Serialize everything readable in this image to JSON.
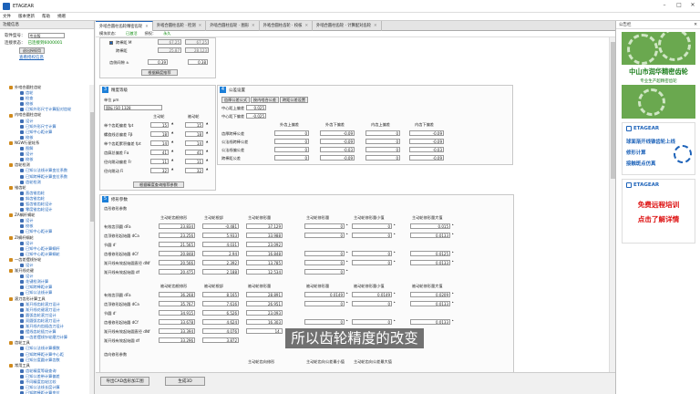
{
  "app": {
    "title": "ETAGEAR"
  },
  "menu": [
    "文件",
    "版本更新",
    "帮助",
    "捐赠"
  ],
  "left": {
    "header": "功能信息",
    "software_label": "软件型号：",
    "software_value": "专业版",
    "conn_label": "连接状态：",
    "conn_value": "已连接到6000001",
    "logout_button": "退出授权用",
    "browse_link": "查看授权信息",
    "tree": [
      {
        "t": "外啮合圆柱齿轮",
        "lv": 0
      },
      {
        "t": "齿轮",
        "lv": 2
      },
      {
        "t": "检查",
        "lv": 2
      },
      {
        "t": "校核",
        "lv": 2
      },
      {
        "t": "已知外形尺寸计算配对齿轮",
        "lv": 2
      },
      {
        "t": "内啮合圆柱齿轮",
        "lv": 0
      },
      {
        "t": "设计",
        "lv": 2
      },
      {
        "t": "已知外形尺寸计算",
        "lv": 2
      },
      {
        "t": "已知中心距计算",
        "lv": 2
      },
      {
        "t": "校核",
        "lv": 2
      },
      {
        "t": "NGW行星轮系",
        "lv": 0
      },
      {
        "t": "图解",
        "lv": 2
      },
      {
        "t": "设计",
        "lv": 2
      },
      {
        "t": "校核",
        "lv": 2
      },
      {
        "t": "齿轮检测",
        "lv": 0
      },
      {
        "t": "已知公法线计算变位系数",
        "lv": 2
      },
      {
        "t": "已知跨棒距计算变位系数",
        "lv": 2
      },
      {
        "t": "齿轮检测",
        "lv": 2
      },
      {
        "t": "锥齿轮",
        "lv": 0
      },
      {
        "t": "直齿锥齿轮",
        "lv": 2
      },
      {
        "t": "斜齿锥齿轮",
        "lv": 2
      },
      {
        "t": "弧齿锥齿轮设计",
        "lv": 2
      },
      {
        "t": "零度锥齿轮设计",
        "lv": 2
      },
      {
        "t": "ZA蜗杆蜗轮",
        "lv": 0
      },
      {
        "t": "设计",
        "lv": 2
      },
      {
        "t": "校核",
        "lv": 2
      },
      {
        "t": "已知中心距计算",
        "lv": 2
      },
      {
        "t": "ZI蜗杆蜗轮",
        "lv": 0
      },
      {
        "t": "设计",
        "lv": 2
      },
      {
        "t": "已知中心距计算蜗杆",
        "lv": 2
      },
      {
        "t": "已知中心距计算蜗轮",
        "lv": 2
      },
      {
        "t": "一齿差摆线针轮",
        "lv": 0
      },
      {
        "t": "设计",
        "lv": 2
      },
      {
        "t": "渐开线花键",
        "lv": 0
      },
      {
        "t": "设计",
        "lv": 2
      },
      {
        "t": "花键检测计算",
        "lv": 2
      },
      {
        "t": "已知跨棒距计算",
        "lv": 2
      },
      {
        "t": "已知公法线计算",
        "lv": 2
      },
      {
        "t": "滚刀齿形计算工具",
        "lv": 0
      },
      {
        "t": "渐开线齿轮滚刀设计",
        "lv": 2
      },
      {
        "t": "渐开线花键滚刀设计",
        "lv": 2
      },
      {
        "t": "圆弧齿轮滚刀设计",
        "lv": 2
      },
      {
        "t": "双圆弧齿轮滚刀设计",
        "lv": 2
      },
      {
        "t": "渐开线内齿插齿刀设计",
        "lv": 2
      },
      {
        "t": "摆线齿轮插刀计算",
        "lv": 2
      },
      {
        "t": "一齿差摆线针轮磨刀计算",
        "lv": 2
      },
      {
        "t": "齿轮工具",
        "lv": 0
      },
      {
        "t": "已知公法线计算模数",
        "lv": 2
      },
      {
        "t": "已知跨棒距计算中心距",
        "lv": 2
      },
      {
        "t": "已知分度圆计算齿数",
        "lv": 2
      },
      {
        "t": "常用工具",
        "lv": 0
      },
      {
        "t": "齿轮精度等级查询",
        "lv": 2
      },
      {
        "t": "已知公差带计算偏差",
        "lv": 2
      },
      {
        "t": "不同精度齿轮比较",
        "lv": 2
      },
      {
        "t": "已知公法线长度计算",
        "lv": 2
      },
      {
        "t": "已知跨棒距计算变位",
        "lv": 2
      }
    ]
  },
  "tabs": [
    {
      "label": "外啮合圆柱齿轮精密齿轮",
      "active": true
    },
    {
      "label": "外啮合圆柱齿轮 · 检测",
      "active": false
    },
    {
      "label": "外啮合圆柱齿轮 · 图形",
      "active": false
    },
    {
      "label": "外啮合圆柱齿轮 · 校核",
      "active": false
    },
    {
      "label": "外啮合圆柱齿轮 · 计算配对齿轮",
      "active": false
    }
  ],
  "status": {
    "a": "模块状态：",
    "b": "已激活",
    "c": "授权：",
    "d": "永久"
  },
  "top_section": {
    "r1_label": "跨棒距 M",
    "r1_v1": "67.25",
    "r1_v2": "67.25",
    "r2_label": "跨棒距",
    "r2_v1": "25.87",
    "r2_v2": "28.123",
    "r3_label": "齿侧间隙 ±",
    "r3_v1": "0.39",
    "r3_v2": "0.38",
    "button": "根据精度推荐"
  },
  "precision": {
    "num": "3",
    "title": "精度等级",
    "unit_label": "单位 µm",
    "standard": "国标 ISO 1328",
    "col1": "主动轮",
    "col2": "被动轮",
    "rows": [
      {
        "l": "单个齿距偏差 fpt",
        "a": "15",
        "b": "15"
      },
      {
        "l": "螺旋线总偏差 Fβ",
        "a": "18",
        "b": "18"
      },
      {
        "l": "单个齿距累积偏差 fpt",
        "a": "14",
        "b": "14"
      },
      {
        "l": "齿廓总偏差 Fα",
        "a": "41",
        "b": "41"
      },
      {
        "l": "径向跳动偏差 Fr",
        "a": "11",
        "b": "11"
      },
      {
        "l": "径向跳动 Fi",
        "a": "32",
        "b": "32"
      }
    ],
    "button": "根据精度查询推荐参数"
  },
  "tolerance": {
    "num": "4",
    "title": "公差设置",
    "btn1": "齿厚公差公式",
    "btn2": "按内啮合公差",
    "btn3": "跨距公差设置",
    "r1": "中心距上偏差",
    "r1v": "0.025",
    "r2": "中心距下偏差",
    "r2v": "-0.025",
    "cols": [
      "外齿上偏差",
      "外齿下偏差",
      "内齿上偏差",
      "内齿下偏差"
    ],
    "rows": [
      {
        "l": "齿厚跨棒公差",
        "v": [
          "0",
          "-0.09",
          "0",
          "-0.09"
        ]
      },
      {
        "l": "公法线跨棒公差",
        "v": [
          "0",
          "-0.09",
          "0",
          "-0.09"
        ]
      },
      {
        "l": "公法线偏公差",
        "v": [
          "0",
          "-0.03",
          "0",
          "-0.03"
        ]
      },
      {
        "l": "跨棒距公差",
        "v": [
          "0",
          "-0.09",
          "0",
          "-0.09"
        ]
      }
    ]
  },
  "measure": {
    "num": "5",
    "title": "修形参数",
    "section1": "齿形修形参数",
    "headers": [
      "主动轮齿根修形",
      "主动轮根部",
      "主动轮修形量",
      "主动轮修形量",
      "主动轮修形量小值",
      "主动轮修形量大值"
    ],
    "rows1": [
      {
        "l": "有效齿顶圆 dFa",
        "v": [
          "23.834",
          "-0.481",
          "37.129",
          "0",
          "0",
          "0.015"
        ]
      },
      {
        "l": "齿顶修形起始圆 dCa",
        "v": [
          "23.256",
          "5.933",
          "33.988",
          "0",
          "0",
          "0.0133"
        ]
      },
      {
        "l": "节圆 d'",
        "v": [
          "21.565",
          "4.031",
          "23.092",
          "",
          "",
          ""
        ]
      },
      {
        "l": "齿根修形起始圆 dCf",
        "v": [
          "20.848",
          "2.94",
          "16.848",
          "0",
          "0",
          "0.0125"
        ]
      },
      {
        "l": "渐开线有效起始圆直径 dNf",
        "v": [
          "20.566",
          "2.392",
          "13.785",
          "0",
          "0",
          "0.0133"
        ]
      },
      {
        "l": "渐开线有效起始圆 df",
        "v": [
          "20.475",
          "2.188",
          "12.534",
          "0",
          "",
          ""
        ]
      }
    ],
    "headers2": [
      "被动轮齿根修形",
      "被动轮根部",
      "被动轮修形量",
      "被动轮修形量",
      "被动轮修形量小值",
      "被动轮修形量大值"
    ],
    "rows2": [
      {
        "l": "有效齿顶圆 dFa",
        "v": [
          "36.268",
          "8.165",
          "28.891",
          "0.0149",
          "0.0149",
          "0.0209"
        ]
      },
      {
        "l": "齿顶修形起始圆 dCa",
        "v": [
          "35.767",
          "7.616",
          "26.951",
          "0",
          "0",
          "0.0133"
        ]
      },
      {
        "l": "节圆 d'",
        "v": [
          "34.915",
          "6.526",
          "23.093",
          "",
          "",
          ""
        ]
      },
      {
        "l": "齿根修形起始圆 dCf",
        "v": [
          "33.678",
          "4.624",
          "16.303",
          "0",
          "0",
          "0.0133"
        ]
      },
      {
        "l": "渐开线有效起始圆直径 dNf",
        "v": [
          "33.394",
          "4.076",
          "14.",
          "",
          "",
          ""
        ]
      },
      {
        "l": "渐开线有效起始圆 df",
        "v": [
          "33.296",
          "3.872",
          "",
          "",
          "",
          ""
        ]
      }
    ],
    "section2": "齿向修形参数",
    "headers3": [
      "主动轮齿向修形",
      "主动轮齿向公差最小值",
      "主动轮齿向公差最大值"
    ]
  },
  "bottom": {
    "b1": "导出CAD齿形加工图",
    "b2": "生成3D"
  },
  "right": {
    "header": "公告栏",
    "ad1_title": "中山市润华精密齿轮",
    "ad1_sub": "专业生产超精密齿轮",
    "etagear": "ETAGEAR",
    "ad2_l1": "球面渐开线锥齿轮上线",
    "ad2_l2": "修形计算",
    "ad2_l3": "接触斑点仿真",
    "ad3_l1": "免费远程培训",
    "ad3_l2": "点击了解详情"
  },
  "subtitle": "所以齿轮精度的改变"
}
